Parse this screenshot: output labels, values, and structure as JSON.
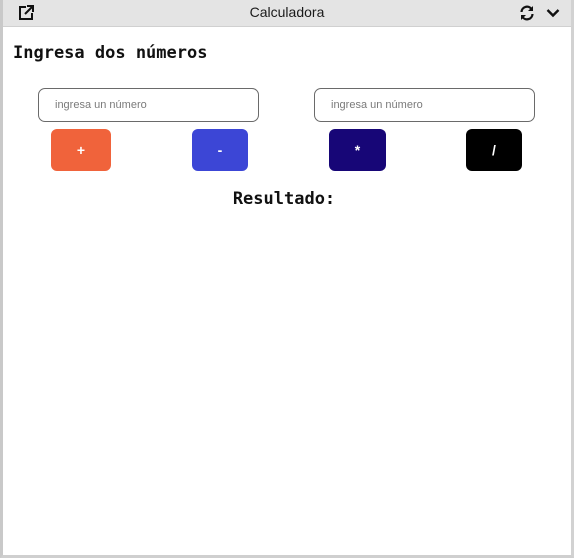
{
  "window": {
    "title": "Calculadora",
    "icons": [
      "external-link-icon",
      "refresh-icon",
      "chevron-down-icon"
    ]
  },
  "main": {
    "heading": "Ingresa dos números",
    "inputs": [
      {
        "value": "",
        "placeholder": "ingresa un número"
      },
      {
        "value": "",
        "placeholder": "ingresa un número"
      }
    ],
    "buttons": [
      {
        "label": "+",
        "color": "#f0633b"
      },
      {
        "label": "-",
        "color": "#3c46d6"
      },
      {
        "label": "*",
        "color": "#170677"
      },
      {
        "label": "/",
        "color": "#000000"
      }
    ],
    "result_label": "Resultado:",
    "result_value": ""
  }
}
